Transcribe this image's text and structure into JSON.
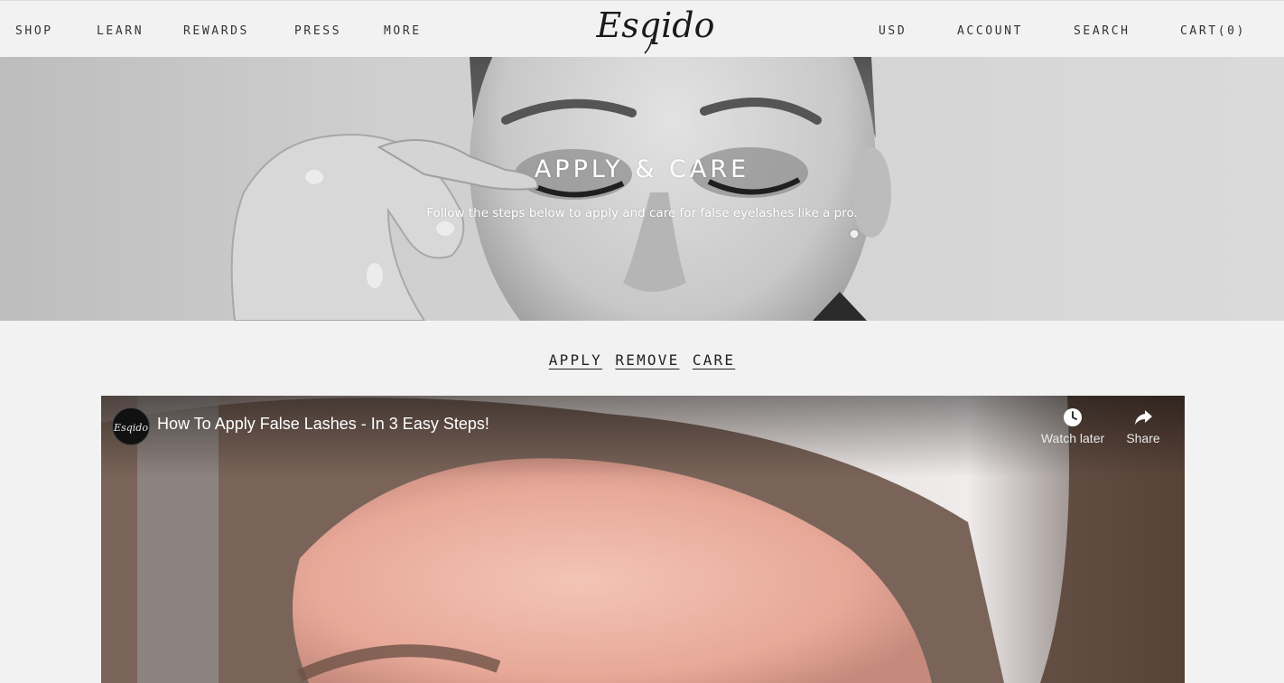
{
  "header": {
    "nav_left": [
      "SHOP",
      "LEARN",
      "REWARDS",
      "PRESS",
      "MORE"
    ],
    "logo_text": "Esqido",
    "nav_right": [
      "USD",
      "ACCOUNT",
      "SEARCH",
      "CART(0)"
    ]
  },
  "hero": {
    "title": "APPLY & CARE",
    "subtitle": "Follow the steps below to apply and care for false eyelashes like a pro."
  },
  "tabs": [
    "APPLY",
    "REMOVE",
    "CARE"
  ],
  "video": {
    "title": "How To Apply False Lashes - In 3 Easy Steps!",
    "watch_later_label": "Watch later",
    "share_label": "Share",
    "watch_later_icon": "clock-icon",
    "share_icon": "share-arrow-icon"
  }
}
